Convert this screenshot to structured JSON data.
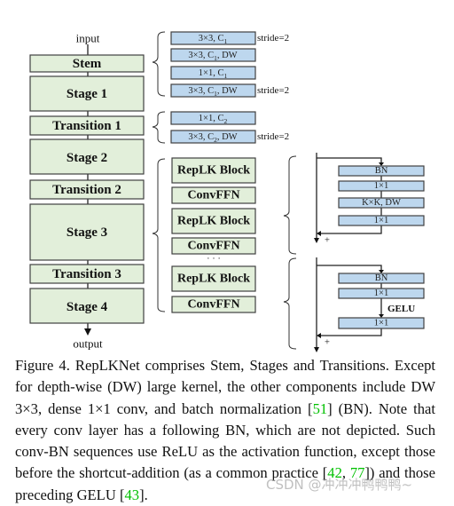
{
  "figure": {
    "input_label": "input",
    "output_label": "output",
    "main_column": [
      {
        "id": "stem",
        "label": "Stem"
      },
      {
        "id": "stage1",
        "label": "Stage 1"
      },
      {
        "id": "transition1",
        "label": "Transition 1"
      },
      {
        "id": "stage2",
        "label": "Stage 2"
      },
      {
        "id": "transition2",
        "label": "Transition 2"
      },
      {
        "id": "stage3",
        "label": "Stage 3"
      },
      {
        "id": "transition3",
        "label": "Transition 3"
      },
      {
        "id": "stage4",
        "label": "Stage 4"
      }
    ],
    "stem_detail": [
      {
        "text": "3×3, C",
        "sub": "1",
        "suffix": "",
        "note": "stride=2"
      },
      {
        "text": "3×3, C",
        "sub": "1",
        "suffix": ", DW",
        "note": ""
      },
      {
        "text": "1×1, C",
        "sub": "1",
        "suffix": "",
        "note": ""
      },
      {
        "text": "3×3, C",
        "sub": "1",
        "suffix": ", DW",
        "note": "stride=2"
      }
    ],
    "transition_detail": [
      {
        "text": "1×1, C",
        "sub": "2",
        "suffix": "",
        "note": ""
      },
      {
        "text": "3×3, C",
        "sub": "2",
        "suffix": ", DW",
        "note": "stride=2"
      }
    ],
    "stage_detail": [
      "RepLK Block",
      "ConvFFN",
      "RepLK Block",
      "ConvFFN",
      "· · ·",
      "RepLK Block",
      "ConvFFN"
    ],
    "replk_block_detail": {
      "layers": [
        "BN",
        "1×1",
        "K×K, DW",
        "1×1"
      ],
      "add_symbol": "+"
    },
    "convffn_detail": {
      "layers": [
        "BN",
        "1×1",
        "1×1"
      ],
      "activation": "GELU",
      "add_symbol": "+"
    }
  },
  "caption": {
    "prefix": "Figure 4. RepLKNet comprises Stem, Stages and Transitions. Except for depth-wise (DW) large kernel, the other components include DW 3×3, dense 1×1 conv, and batch normalization ",
    "cite1": "51",
    "mid1": " (BN). Note that every conv layer has a following BN, which are not depicted. Such conv-BN sequences use ReLU as the activation function, except those before the shortcut-addition (as a common practice [",
    "cite2": "42",
    "sep": ", ",
    "cite3": "77",
    "mid2": "]) and those preceding GELU [",
    "cite4": "43",
    "suffix": "]."
  },
  "watermark": "CSDN @冲冲冲鸭鸭鸭~"
}
